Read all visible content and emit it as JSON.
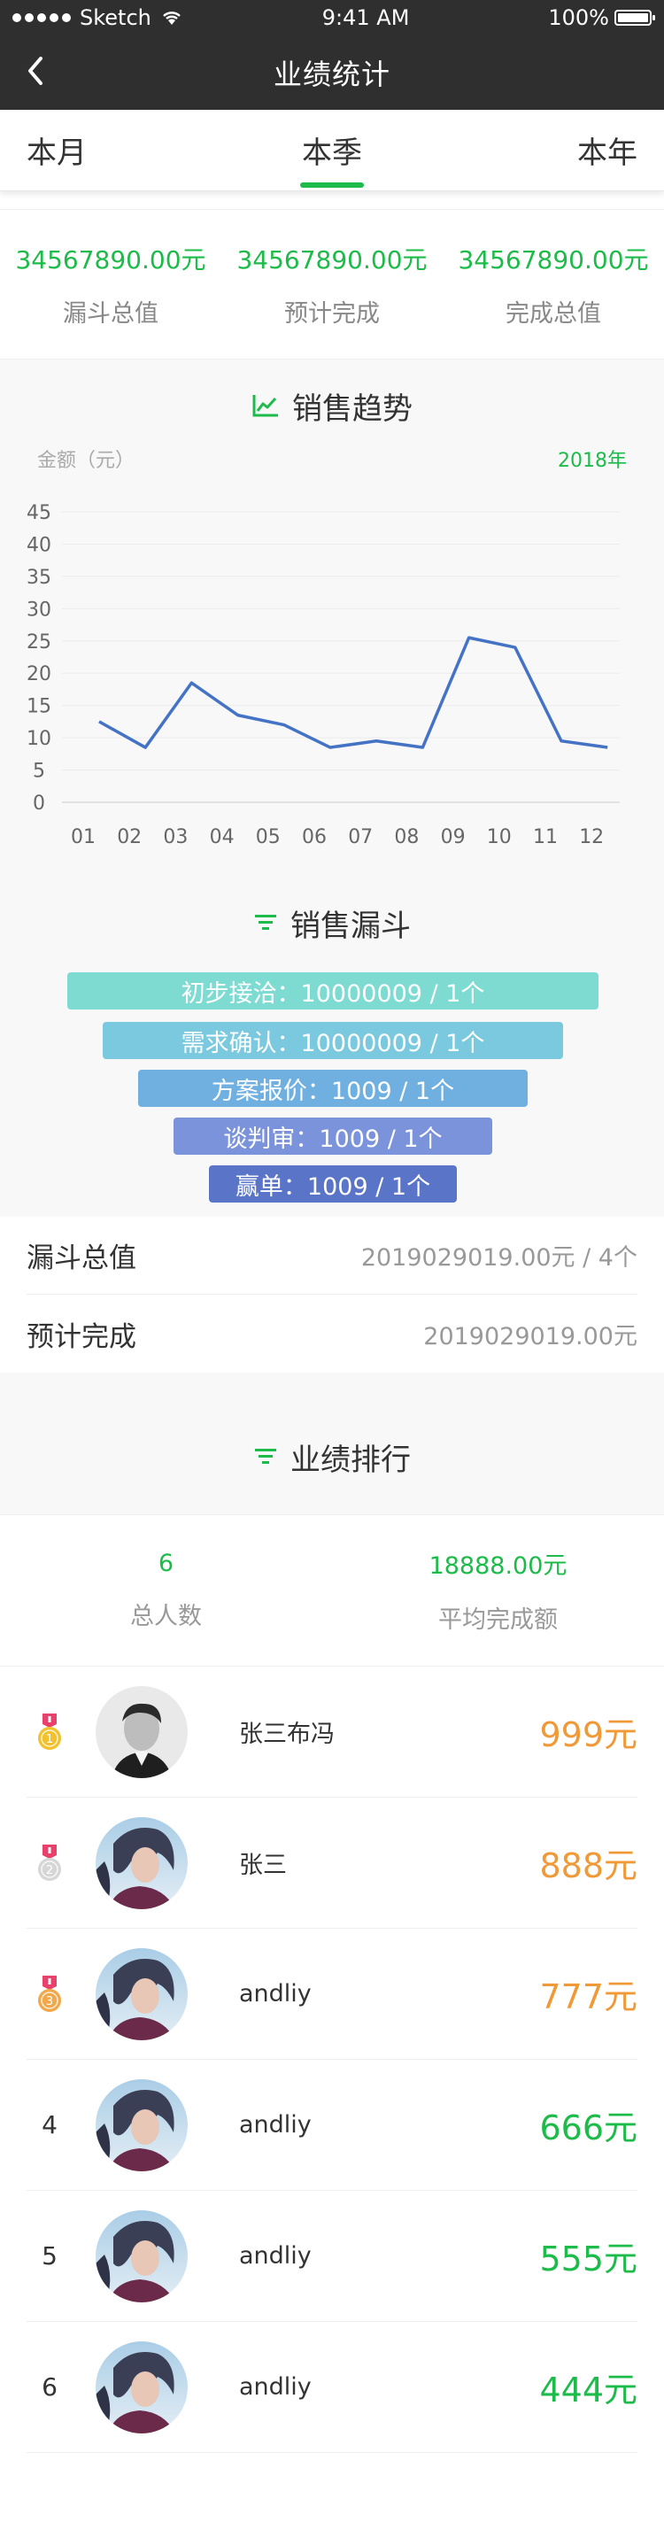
{
  "status": {
    "carrier": "Sketch",
    "time": "9:41 AM",
    "battery": "100%"
  },
  "nav": {
    "title": "业绩统计"
  },
  "tabs": [
    {
      "label": "本月",
      "active": false
    },
    {
      "label": "本季",
      "active": true
    },
    {
      "label": "本年",
      "active": false
    }
  ],
  "summary": [
    {
      "value": "34567890.00元",
      "label": "漏斗总值"
    },
    {
      "value": "34567890.00元",
      "label": "预计完成"
    },
    {
      "value": "34567890.00元",
      "label": "完成总值"
    }
  ],
  "trend": {
    "title": "销售趋势",
    "unit_label": "金额（元）",
    "year_label": "2018年"
  },
  "chart_data": {
    "type": "line",
    "x": [
      "01",
      "02",
      "03",
      "04",
      "05",
      "06",
      "07",
      "08",
      "09",
      "10",
      "11",
      "12"
    ],
    "series": [
      {
        "values": [
          12.5,
          8.5,
          18.5,
          13.5,
          12,
          8.5,
          9.5,
          8.5,
          25.5,
          24,
          9.5,
          8.5
        ]
      }
    ],
    "yticks": [
      0,
      5,
      10,
      15,
      20,
      25,
      30,
      35,
      40,
      45
    ],
    "ylim": [
      0,
      45
    ],
    "grid": true,
    "line_color": "#4472c4"
  },
  "funnel": {
    "title": "销售漏斗",
    "stages": [
      {
        "label": "初步接洽：10000009 / 1个",
        "color": "#7edbd2"
      },
      {
        "label": "需求确认：10000009 / 1个",
        "color": "#7ac9de"
      },
      {
        "label": "方案报价：1009 / 1个",
        "color": "#6fb0e0"
      },
      {
        "label": "谈判审：1009 / 1个",
        "color": "#7b93da"
      },
      {
        "label": "赢单：1009 / 1个",
        "color": "#5a75c8"
      }
    ]
  },
  "totals": [
    {
      "key": "漏斗总值",
      "value": "2019029019.00元 / 4个"
    },
    {
      "key": "预计完成",
      "value": "2019029019.00元"
    }
  ],
  "ranking": {
    "title": "业绩排行",
    "people_count": "6",
    "people_label": "总人数",
    "avg_amount": "18888.00元",
    "avg_label": "平均完成额",
    "items": [
      {
        "rank": "1",
        "medal": "gold",
        "name": "张三布冯",
        "amount": "999元",
        "avatar": "man",
        "color": "#f09a37"
      },
      {
        "rank": "2",
        "medal": "silver",
        "name": "张三",
        "amount": "888元",
        "avatar": "woman",
        "color": "#f09a37"
      },
      {
        "rank": "3",
        "medal": "bronze",
        "name": "andliy",
        "amount": "777元",
        "avatar": "woman",
        "color": "#f09a37"
      },
      {
        "rank": "4",
        "medal": "",
        "name": "andliy",
        "amount": "666元",
        "avatar": "woman",
        "color": "#1dbb4a"
      },
      {
        "rank": "5",
        "medal": "",
        "name": "andliy",
        "amount": "555元",
        "avatar": "woman",
        "color": "#1dbb4a"
      },
      {
        "rank": "6",
        "medal": "",
        "name": "andliy",
        "amount": "444元",
        "avatar": "woman",
        "color": "#1dbb4a"
      }
    ]
  },
  "colors": {
    "accent": "#1dbb4a",
    "amount_top": "#f09a37",
    "navbar": "#2f2f2f"
  }
}
